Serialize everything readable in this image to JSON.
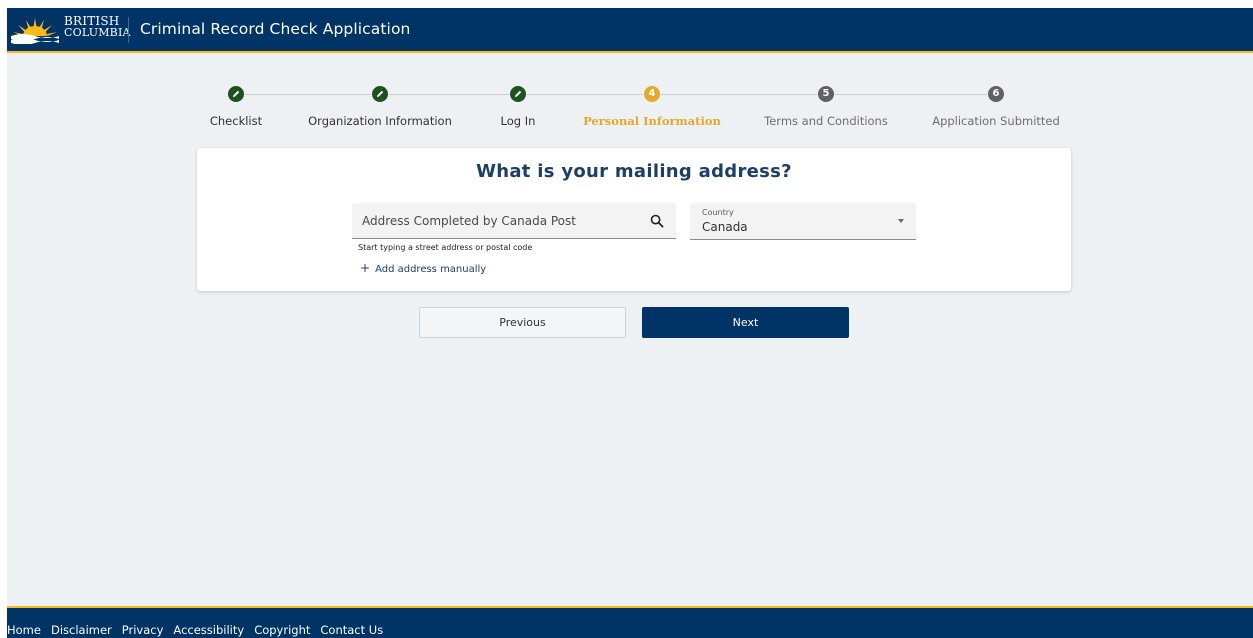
{
  "header": {
    "logo_line1": "BRITISH",
    "logo_line2": "COLUMBIA",
    "title": "Criminal Record Check Application"
  },
  "stepper": {
    "steps": [
      {
        "label": "Checklist",
        "status": "complete",
        "icon": "check-pencil-icon"
      },
      {
        "label": "Organization Information",
        "status": "complete",
        "icon": "check-pencil-icon"
      },
      {
        "label": "Log In",
        "status": "complete",
        "icon": "check-pencil-icon"
      },
      {
        "label": "Personal Information",
        "status": "active",
        "number": "4"
      },
      {
        "label": "Terms and Conditions",
        "status": "pending",
        "number": "5"
      },
      {
        "label": "Application Submitted",
        "status": "pending",
        "number": "6"
      }
    ]
  },
  "form": {
    "question": "What is your mailing address?",
    "address": {
      "placeholder": "Address Completed by Canada Post",
      "value": "",
      "hint": "Start typing a street address or postal code",
      "icon": "search-icon"
    },
    "add_manually": {
      "icon": "plus-icon",
      "label": "Add address manually"
    },
    "country": {
      "label": "Country",
      "value": "Canada",
      "icon": "caret-down-icon"
    }
  },
  "actions": {
    "previous_label": "Previous",
    "next_label": "Next"
  },
  "footer": {
    "links": [
      "Home",
      "Disclaimer",
      "Privacy",
      "Accessibility",
      "Copyright",
      "Contact Us"
    ]
  },
  "colors": {
    "brand_navy": "#003366",
    "brand_gold": "#fcba19",
    "step_complete": "#1e5220",
    "step_active": "#e3a82b",
    "step_pending": "#616161"
  }
}
